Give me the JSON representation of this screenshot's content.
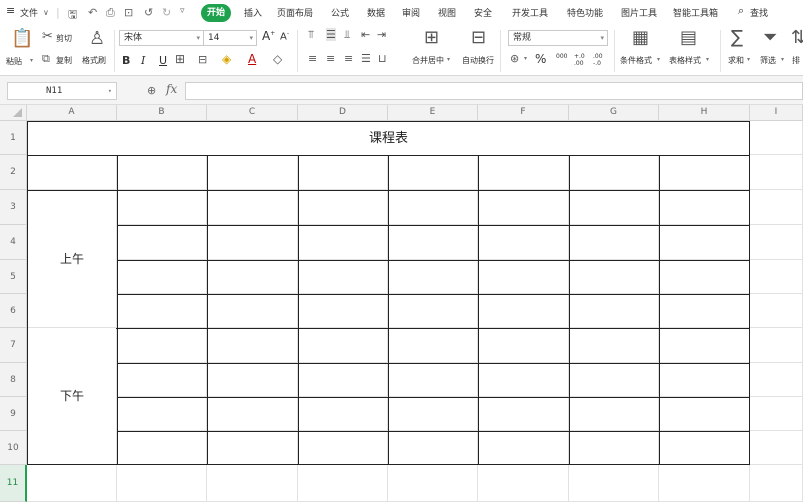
{
  "menu": {
    "hamburger": "≡",
    "file": "文件",
    "quick_access_icons": [
      "save-icon",
      "undo-history-icon",
      "print-icon",
      "print-preview-icon",
      "undo-icon",
      "redo-icon",
      "more-icon"
    ],
    "tabs": [
      "开始",
      "插入",
      "页面布局",
      "公式",
      "数据",
      "审阅",
      "视图",
      "安全",
      "开发工具",
      "特色功能",
      "图片工具",
      "智能工具箱"
    ],
    "active_tab": "开始",
    "search_label": "查找",
    "accent_color": "#1fa24e"
  },
  "ribbon": {
    "paste": "粘贴",
    "cut": "剪切",
    "copy": "复制",
    "format_painter": "格式刷",
    "font_name": "宋体",
    "font_size": "14",
    "bold": "B",
    "italic": "I",
    "underline": "U",
    "merge_center": "合并居中",
    "wrap_text": "自动换行",
    "number_format": "常规",
    "percent": "%",
    "thousands": "000",
    "inc_decimal": "+.0 .00",
    "dec_decimal": ".00 -.0",
    "conditional_format": "条件格式",
    "table_style": "表格样式",
    "sum": "求和",
    "filter": "筛选",
    "sort": "排"
  },
  "formula_bar": {
    "cell_ref": "N11",
    "fx": "fx",
    "formula": ""
  },
  "sheet": {
    "columns": [
      "A",
      "B",
      "C",
      "D",
      "E",
      "F",
      "G",
      "H",
      "I"
    ],
    "rows": [
      "1",
      "2",
      "3",
      "4",
      "5",
      "6",
      "7",
      "8",
      "9",
      "10",
      "11"
    ],
    "active_row": "11",
    "title_cell": "课程表",
    "morning_label": "上午",
    "afternoon_label": "下午"
  }
}
